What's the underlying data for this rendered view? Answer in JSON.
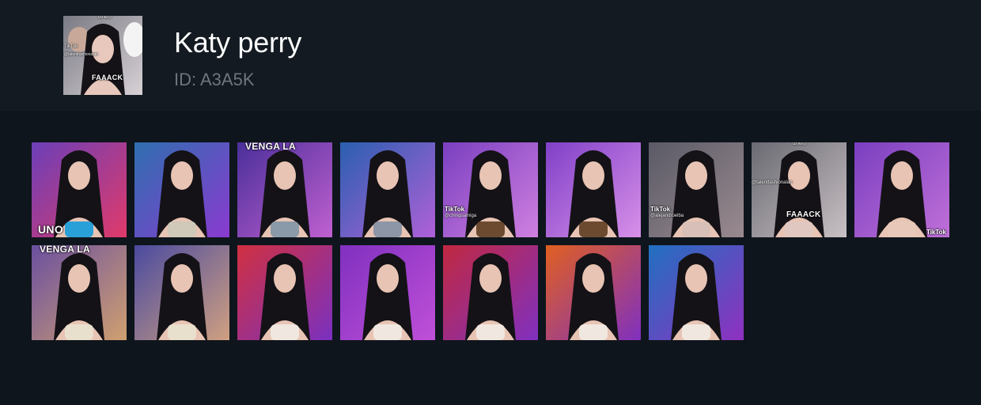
{
  "profile": {
    "name": "Katy perry",
    "id_text": "ID: A3A5K",
    "avatar_overlays": {
      "top": "dinero",
      "tiktok": "TikTok",
      "handle": "@talentfashionalan",
      "caption": "FAAACK"
    }
  },
  "thumbnails": [
    {
      "bg": [
        "#6b3fb8",
        "#e03a6a"
      ],
      "accent": "#29a0d8",
      "overlay": "UNO"
    },
    {
      "bg": [
        "#2f6fb0",
        "#8a3ad0"
      ],
      "accent": "#d0c8b8"
    },
    {
      "bg": [
        "#4a2f9a",
        "#c060d0"
      ],
      "accent": "#8a9aa8",
      "overlay": "VENGA LA"
    },
    {
      "bg": [
        "#2a5fb0",
        "#b060d8"
      ],
      "accent": "#8c96a6"
    },
    {
      "bg": [
        "#7a3fc0",
        "#d080e0"
      ],
      "accent": "#6b4a2f",
      "tiktok": "TikTok",
      "handle": "@chinguamiga"
    },
    {
      "bg": [
        "#8040c8",
        "#d890e8"
      ],
      "accent": "#6b4a2f"
    },
    {
      "bg": [
        "#5a5a66",
        "#9a8a90"
      ],
      "accent": "#d8c0b8",
      "tiktok": "TikTok",
      "handle": "@alejandroelba"
    },
    {
      "bg": [
        "#6a6a72",
        "#c8c0c4"
      ],
      "accent": "#e0c8c0",
      "top": "dinero",
      "caption": "FAAACK",
      "handle": "@talentfashionalan"
    },
    {
      "bg": [
        "#7a3fc0",
        "#c070d8"
      ],
      "accent": "#e8c8b8",
      "tiktok": "TikTok"
    },
    {
      "bg": [
        "#6a4fa0",
        "#d0a070"
      ],
      "accent": "#e8e0cc",
      "overlay": "VENGA LA"
    },
    {
      "bg": [
        "#4a4aa0",
        "#d0a080"
      ],
      "accent": "#e8e0cc"
    },
    {
      "bg": [
        "#d03040",
        "#7a30c0"
      ],
      "accent": "#f0e8e0"
    },
    {
      "bg": [
        "#8030c0",
        "#c050d8"
      ],
      "accent": "#f0e8e0"
    },
    {
      "bg": [
        "#c02840",
        "#8030c0"
      ],
      "accent": "#f0e8e0"
    },
    {
      "bg": [
        "#e06020",
        "#8030c0"
      ],
      "accent": "#f0e8e0"
    },
    {
      "bg": [
        "#2070c0",
        "#9030c0"
      ],
      "accent": "#f0e8e0"
    }
  ],
  "colors": {
    "page_bg": "#0f151c",
    "header_bg": "#131a21",
    "title": "#ffffff",
    "subtitle": "#6e757c"
  }
}
